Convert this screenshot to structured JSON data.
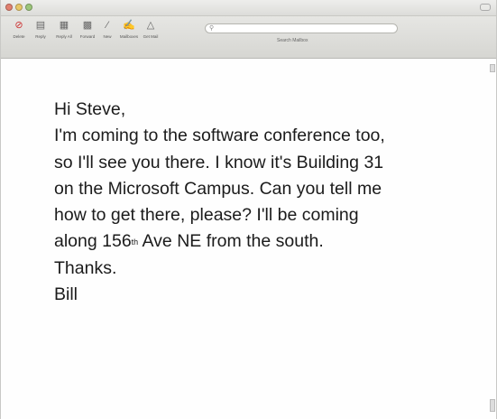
{
  "window": {
    "title": ""
  },
  "toolbar": {
    "buttons": [
      {
        "label": "Delete",
        "icon": "delete-icon"
      },
      {
        "label": "Reply",
        "icon": "reply-icon"
      },
      {
        "label": "Reply All",
        "icon": "reply-all-icon"
      },
      {
        "label": "Forward",
        "icon": "forward-icon"
      },
      {
        "label": "New",
        "icon": "new-message-icon"
      },
      {
        "label": "Mailboxes",
        "icon": "mailboxes-icon"
      },
      {
        "label": "Get Mail",
        "icon": "get-mail-icon"
      }
    ],
    "search_placeholder": "",
    "search_label": "Search Mailbox"
  },
  "message": {
    "greeting": "Hi Steve,",
    "line1": "I'm coming to the software conference too,",
    "line2": "so I'll see you there. I know it's Building 31",
    "line3": "on the Microsoft Campus. Can you tell me",
    "line4": "how to get there, please? I'll be coming",
    "line5_pre": "along 156",
    "line5_sup": "th",
    "line5_post": " Ave NE from the south.",
    "closing": "Thanks.",
    "signature": "Bill"
  }
}
